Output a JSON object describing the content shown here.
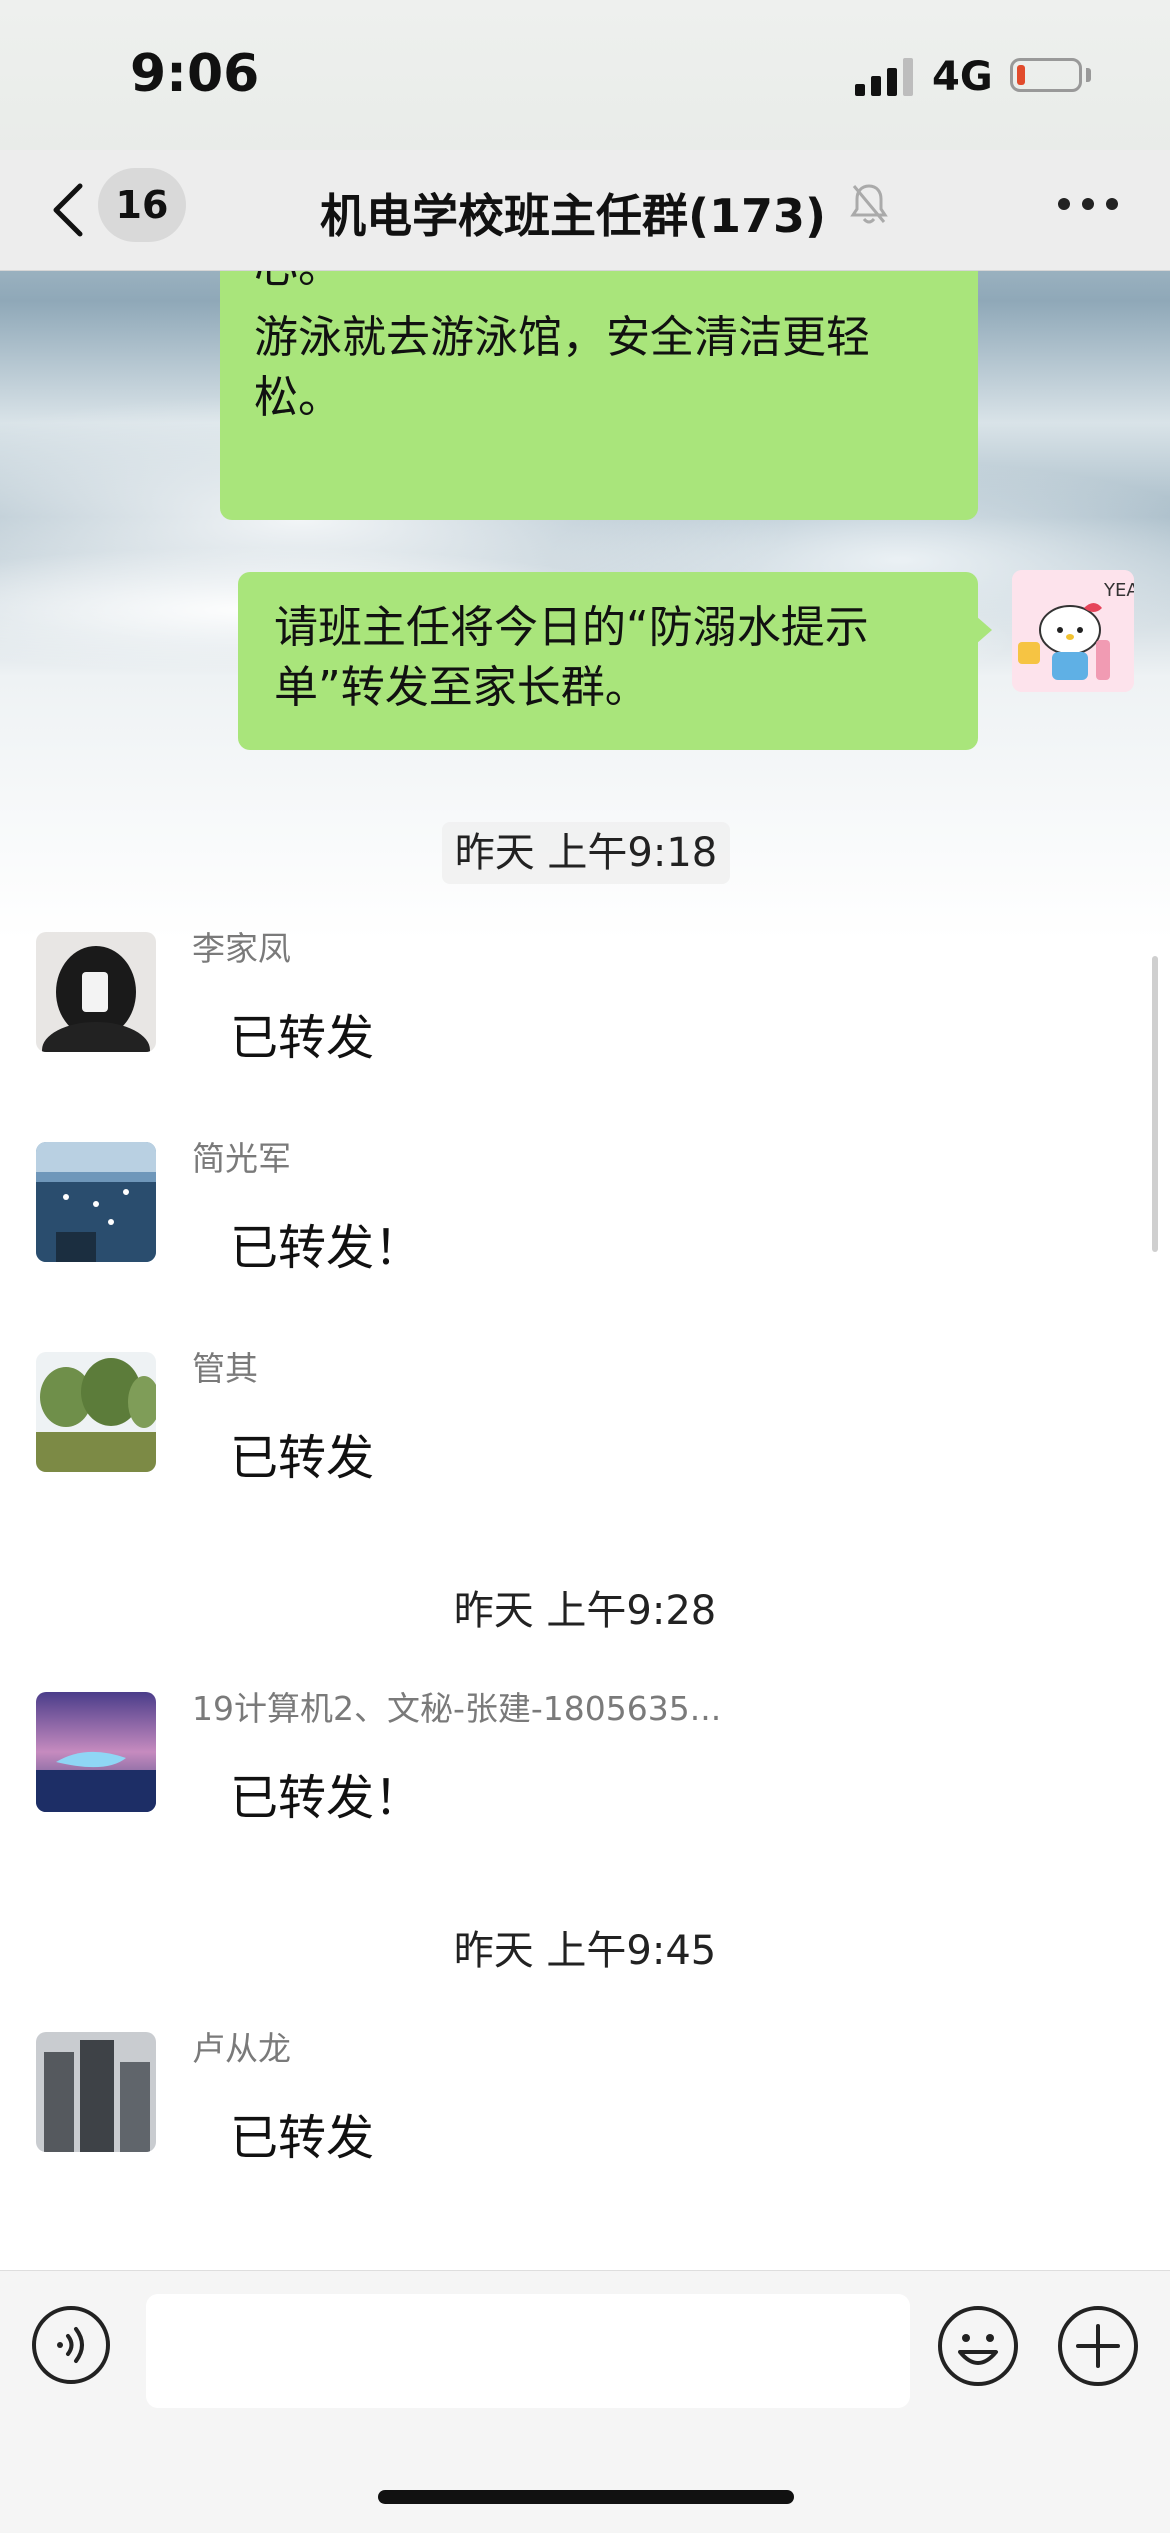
{
  "status_bar": {
    "time": "9:06",
    "network": "4G",
    "battery_level_fraction": 0.1
  },
  "nav": {
    "back_badge": "16",
    "title": "机电学校班主任群(173)",
    "muted_icon": "bell-slash-icon",
    "more_icon": "more-dots-icon"
  },
  "colors": {
    "bubble_green": "#a9e57b",
    "nav_bg": "#ededed",
    "input_bg": "#f5f5f5"
  },
  "own_messages": [
    {
      "line0": "心。",
      "line1": "游泳就去游泳馆，安全清洁更轻",
      "line2": "松。"
    },
    {
      "line1": "请班主任将今日的“防溺水提示",
      "line2": "单”转发至家长群。"
    }
  ],
  "timestamps": [
    "昨天 上午9:18",
    "昨天 上午9:28",
    "昨天 上午9:45"
  ],
  "messages": [
    {
      "sender": "李家凤",
      "text": "已转发"
    },
    {
      "sender": "简光军",
      "text": "已转发！"
    },
    {
      "sender": "管其",
      "text": "已转发"
    },
    {
      "sender": "19计算机2、文秘-张建-1805635...",
      "text": "已转发！"
    },
    {
      "sender": "卢从龙",
      "text": "已转发"
    }
  ],
  "input": {
    "placeholder": "",
    "voice_icon": "voice-icon",
    "emoji_icon": "emoji-icon",
    "plus_icon": "plus-icon"
  }
}
